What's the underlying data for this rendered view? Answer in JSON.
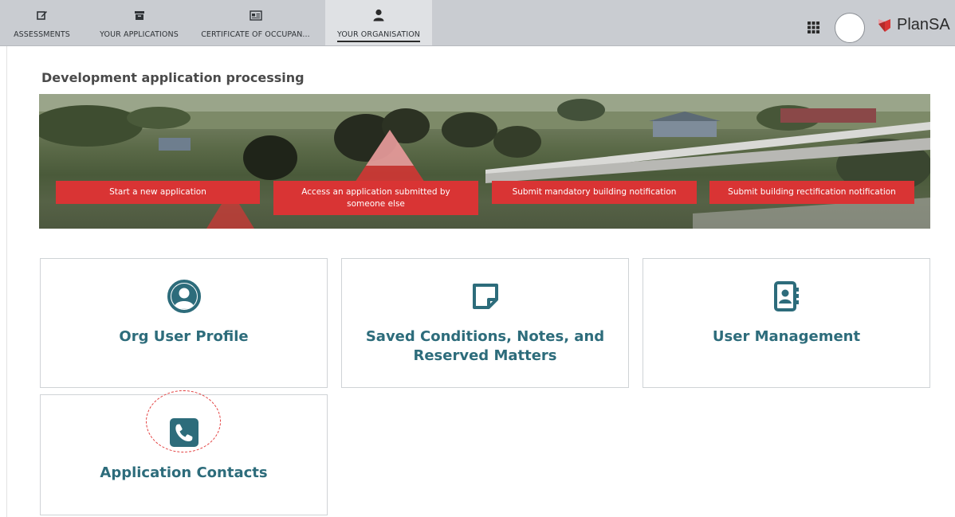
{
  "nav": {
    "tabs": [
      {
        "label": "ASSESSMENTS",
        "icon": "edit-icon"
      },
      {
        "label": "YOUR APPLICATIONS",
        "icon": "archive-icon"
      },
      {
        "label": "CERTIFICATE OF OCCUPAN...",
        "icon": "id-card-icon"
      },
      {
        "label": "YOUR ORGANISATION",
        "icon": "user-icon",
        "active": true
      }
    ],
    "apps_icon": "grid-icon",
    "brand": "PlanSA"
  },
  "main": {
    "section_title": "Development application processing",
    "banner_buttons": [
      {
        "label": "Start a new application"
      },
      {
        "label": "Access an application submitted by someone else"
      },
      {
        "label": "Submit mandatory building notification"
      },
      {
        "label": "Submit building rectification notification"
      }
    ],
    "cards": [
      {
        "title": "Org User Profile",
        "icon": "user-circle-icon"
      },
      {
        "title": "Saved Conditions, Notes, and Reserved Matters",
        "icon": "sticky-note-icon"
      },
      {
        "title": "User Management",
        "icon": "address-book-icon"
      },
      {
        "title": "Application Contacts",
        "icon": "phone-icon"
      }
    ]
  },
  "colors": {
    "accent": "#2d6c7b",
    "button_red": "#d93434",
    "topbar": "#c9ccd1",
    "annotation": "#e23b3b"
  }
}
